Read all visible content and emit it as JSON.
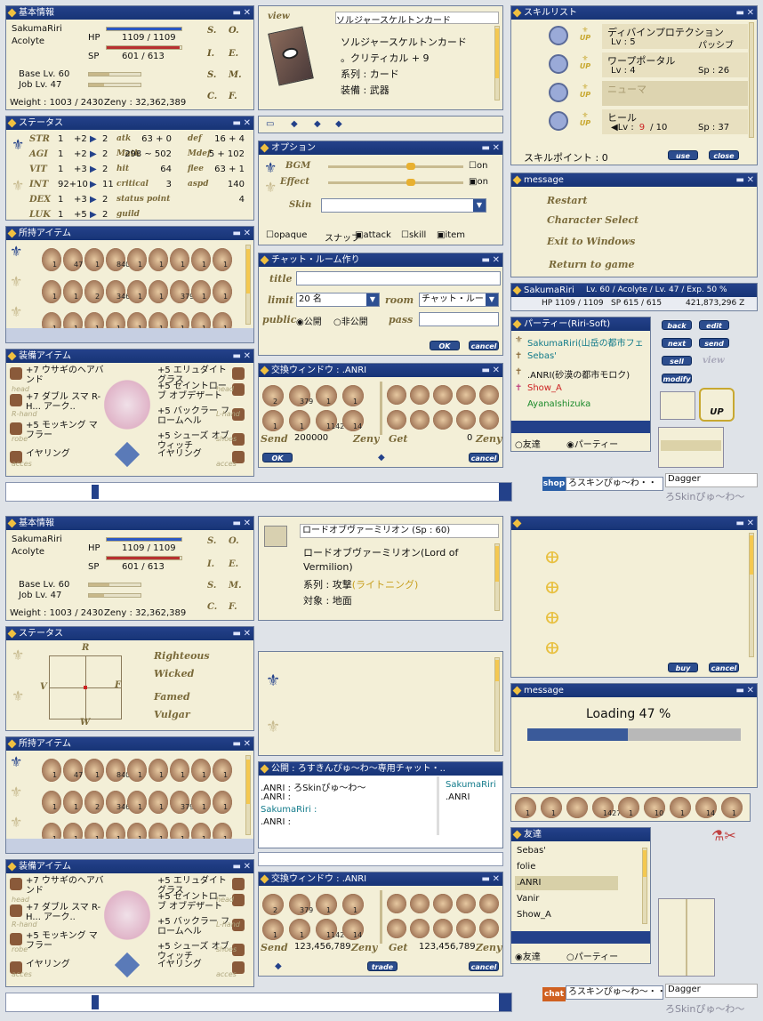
{
  "basic": {
    "title": "基本情報",
    "name": "SakumaRiri",
    "job": "Acolyte",
    "hp_l": "HP",
    "hp": "1109 / 1109",
    "sp_l": "SP",
    "sp": "601 / 613",
    "base": "Base Lv. 60",
    "joblv": "Job Lv. 47",
    "weight": "Weight : 1003 / 2430",
    "zeny": "Zeny : 32,362,389",
    "tabs": [
      "S.",
      "O.",
      "I.",
      "E.",
      "S.",
      "M.",
      "C.",
      "F."
    ]
  },
  "status": {
    "title": "ステータス",
    "stats": [
      {
        "n": "STR",
        "v": "1",
        "b": "+2",
        "p": "2"
      },
      {
        "n": "AGI",
        "v": "1",
        "b": "+2",
        "p": "2"
      },
      {
        "n": "VIT",
        "v": "1",
        "b": "+3",
        "p": "2"
      },
      {
        "n": "INT",
        "v": "92+10",
        "b": "",
        "p": "11"
      },
      {
        "n": "DEX",
        "v": "1",
        "b": "+3",
        "p": "2"
      },
      {
        "n": "LUK",
        "v": "1",
        "b": "+5",
        "p": "2"
      }
    ],
    "sub": [
      {
        "n": "atk",
        "v": "63 + 0"
      },
      {
        "n": "Matk",
        "v": "298 ~ 502"
      },
      {
        "n": "hit",
        "v": "64"
      },
      {
        "n": "critical",
        "v": "3"
      },
      {
        "n": "status point",
        "v": "4"
      },
      {
        "n": "guild",
        "v": ""
      }
    ],
    "sub2": [
      {
        "n": "def",
        "v": "16 + 4"
      },
      {
        "n": "Mdef",
        "v": "5 + 102"
      },
      {
        "n": "flee",
        "v": "63 + 1"
      },
      {
        "n": "aspd",
        "v": "140"
      }
    ],
    "align": [
      "R",
      "F",
      "W",
      "V"
    ],
    "tags": [
      "Righteous",
      "Wicked",
      "Famed",
      "Vulgar"
    ]
  },
  "items": {
    "title": "所持アイテム",
    "counts": [
      "1",
      "47",
      "1",
      "8406",
      "1",
      "1",
      "1",
      "1",
      "1",
      "1",
      "1",
      "2",
      "346",
      "1",
      "1",
      "379",
      "1",
      "1",
      "1",
      "1",
      "1",
      "1",
      "1",
      "1",
      "1",
      "1",
      "1"
    ]
  },
  "equip": {
    "title": "装備アイテム",
    "l": [
      "+7 ウサギのヘアバンド",
      "+7 ダブル スマ R-H... アーク..",
      "+5 モッキング マフラー",
      "イヤリング"
    ],
    "r": [
      "+5 エリュダイト グラス",
      "+5 セイントローブ オブデザート",
      "+5 バックラー フロームヘル",
      "+5 シューズ オブ ウィッチ",
      "イヤリング"
    ],
    "tags": [
      "head",
      "head",
      "R-hand",
      "L-hand",
      "robe",
      "shoes",
      "acces",
      "acces"
    ]
  },
  "view": {
    "label": "view",
    "card": "ソルジャースケルトンカード",
    "d1": "ソルジャースケルトンカード",
    "d2": "。クリティカル + 9",
    "d3": "系列 : カード",
    "d4": "装備 : 武器"
  },
  "option": {
    "title": "オプション",
    "bgm": "BGM",
    "effect": "Effect",
    "skin": "Skin",
    "on": "on",
    "r": [
      "opaque",
      "スナップ",
      "attack",
      "skill",
      "item"
    ]
  },
  "chat": {
    "title": "チャット・ルーム作り",
    "t": "title",
    "limit": "limit",
    "lv": "20 名",
    "room": "room",
    "rv": "チャット・ルー",
    "pub": "public",
    "p1": "公開",
    "p2": "非公開",
    "pass": "pass",
    "ok": "OK",
    "cancel": "cancel"
  },
  "trade1": {
    "title": "交換ウィンドウ : .ANRI",
    "send": "Send",
    "sv": "200000",
    "zeny": "Zeny",
    "get": "Get",
    "gv": "0",
    "ok": "OK",
    "cancel": "cancel",
    "counts": [
      "2",
      "379",
      "1",
      "1",
      "1",
      "1",
      "1142",
      "14"
    ]
  },
  "skill": {
    "title": "スキルリスト",
    "list": [
      {
        "n": "ディバインプロテクション",
        "l": "Lv : 5",
        "t": "パッシブ"
      },
      {
        "n": "ワープポータル",
        "l": "Lv : 4",
        "t": "Sp : 26"
      },
      {
        "n": "ニューマ",
        "l": "",
        "t": ""
      },
      {
        "n": "ヒール",
        "l": "Lv :",
        "cur": "9",
        "max": "/ 10",
        "t": "Sp : 37"
      }
    ],
    "up": "UP",
    "pt": "スキルポイント : 0",
    "use": "use",
    "close": "close"
  },
  "menu": {
    "title": "message",
    "items": [
      "Restart",
      "Character Select",
      "Exit to Windows",
      "Return to game"
    ]
  },
  "info": {
    "name": "SakumaRiri",
    "lv": "Lv. 60 / Acolyte / Lv. 47 / Exp. 50 %",
    "hp": "HP 1109 / 1109",
    "sp": "SP 615 / 615",
    "z": "421,873,296 Z"
  },
  "party": {
    "title": "パーティー(Riri-Soft)",
    "mem": [
      "SakumaRiri(山岳の都市フェ",
      "Sebas'",
      ".ANRI(砂漠の都市モロク)",
      "Show_A",
      "AyanaIshizuka"
    ],
    "t1": "友達",
    "t2": "パーティー"
  },
  "shopbtns": {
    "b": [
      "back",
      "edit",
      "next",
      "send",
      "sell",
      "view",
      "modify"
    ],
    "up": "UP"
  },
  "shop": {
    "tag": "shop",
    "txt": "ろスキンぴゅ〜わ・・",
    "dg": "Dagger",
    "sub": "ろSkinぴゅ〜わ〜"
  },
  "skill2": {
    "name": "ロードオブヴァーミリオン (Sp : 60)",
    "d1": "ロードオブヴァーミリオン(Lord of",
    "d2": "Vermilion)",
    "d3": "系列 : 攻撃",
    "d3b": "(ライトニング)",
    "d4": "対象 : 地面"
  },
  "buy": {
    "buy": "buy",
    "cancel": "cancel"
  },
  "loading": {
    "title": "message",
    "txt": "Loading 47 %",
    "pct": 47
  },
  "pchat": {
    "title": "公開 : ろすきんぴゅ〜わ〜専用チャット・..",
    "lines": [
      ".ANRI : ろSkinぴゅ〜わ〜",
      ".ANRI :",
      "SakumaRiri :",
      ".ANRI :"
    ],
    "mem": [
      "SakumaRiri",
      ".ANRI"
    ]
  },
  "trade2": {
    "title": "交換ウィンドウ : .ANRI",
    "send": "Send",
    "sv": "123,456,789",
    "zeny": "Zeny",
    "get": "Get",
    "gv": "123,456,789",
    "trade": "trade",
    "cancel": "cancel"
  },
  "hotbar": {
    "counts": [
      "1",
      "1",
      "",
      "142791",
      "1",
      "10",
      "1",
      "14",
      "1"
    ]
  },
  "friends": {
    "title": "友達",
    "list": [
      "Sebas'",
      "folie",
      ".ANRI",
      "Vanir",
      "Show_A"
    ],
    "t1": "友達",
    "t2": "パーティー"
  },
  "chatbar": {
    "tag": "chat",
    "txt": "ろスキンぴゅ〜わ〜・・",
    "dg": "Dagger",
    "sub": "ろSkinぴゅ〜わ〜"
  }
}
